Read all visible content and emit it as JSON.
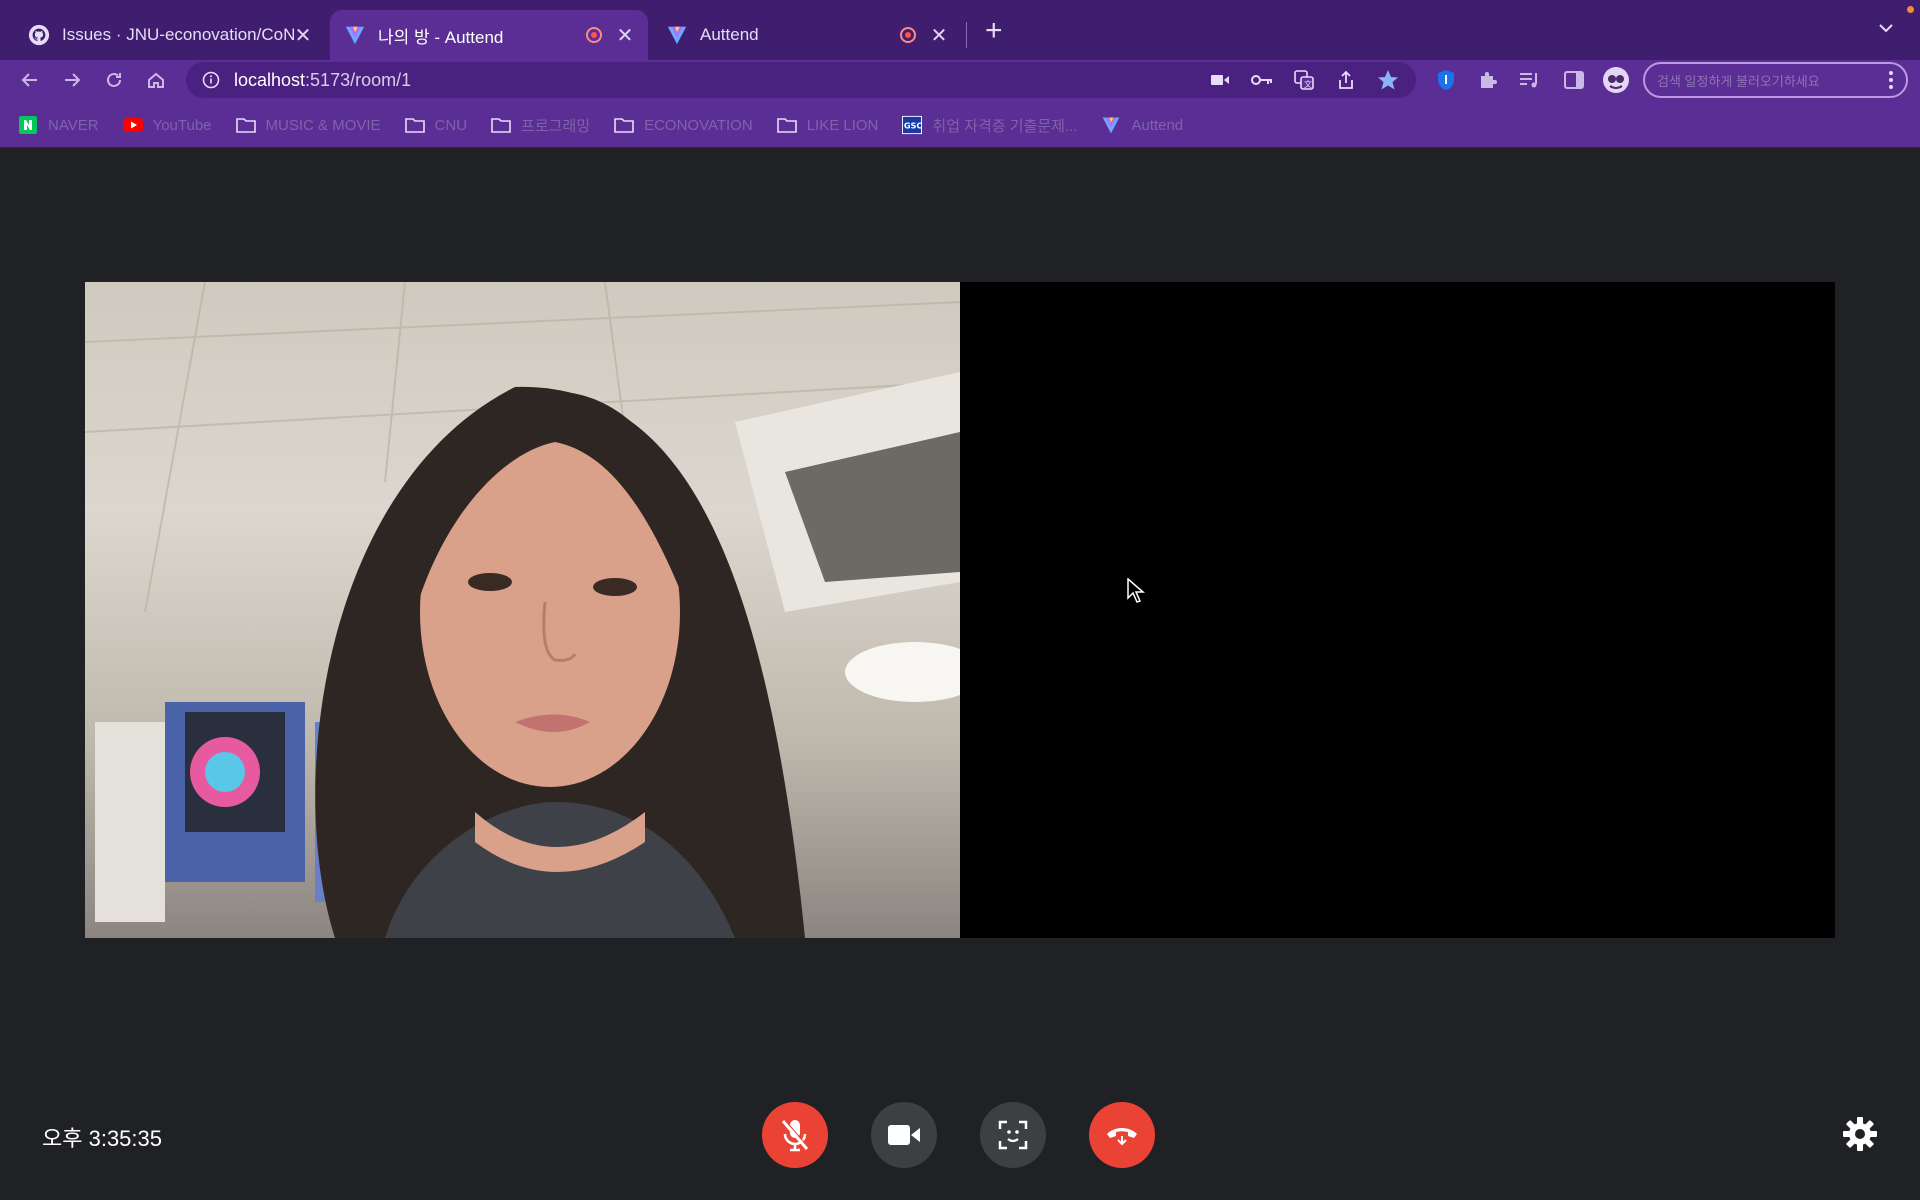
{
  "browser": {
    "tabs": [
      {
        "title": "Issues · JNU-econovation/CoN",
        "active": false,
        "recording": false
      },
      {
        "title": "나의 방 - Auttend",
        "active": true,
        "recording": true
      },
      {
        "title": "Auttend",
        "active": false,
        "recording": true
      }
    ],
    "address": {
      "host": "localhost",
      "path": ":5173/room/1"
    },
    "profile_search_text": "검색 일정하게 불러오기하세요",
    "bookmarks": [
      {
        "label": "NAVER",
        "icon": "naver-icon"
      },
      {
        "label": "YouTube",
        "icon": "youtube-icon"
      },
      {
        "label": "MUSIC & MOVIE",
        "icon": "folder-icon"
      },
      {
        "label": "CNU",
        "icon": "folder-icon"
      },
      {
        "label": "프로그래밍",
        "icon": "folder-icon"
      },
      {
        "label": "ECONOVATION",
        "icon": "folder-icon"
      },
      {
        "label": "LIKE LION",
        "icon": "folder-icon"
      },
      {
        "label": "취업 자격증 기출문제...",
        "icon": "gsc-icon"
      },
      {
        "label": "Auttend",
        "icon": "auttend-icon"
      }
    ],
    "colors": {
      "tabstrip": "#3f1e6f",
      "toolbar": "#5b2e95"
    }
  },
  "page": {
    "clock": "오후 3:35:35",
    "controls": [
      {
        "name": "mute-mic-button",
        "icon": "mic-off-icon",
        "color": "#ea4335"
      },
      {
        "name": "camera-button",
        "icon": "video-camera-icon",
        "color": "#3c4043"
      },
      {
        "name": "face-scan-button",
        "icon": "face-scan-icon",
        "color": "#3c4043"
      },
      {
        "name": "hang-up-button",
        "icon": "phone-hangup-icon",
        "color": "#ea4335"
      }
    ],
    "background": "#202124"
  }
}
